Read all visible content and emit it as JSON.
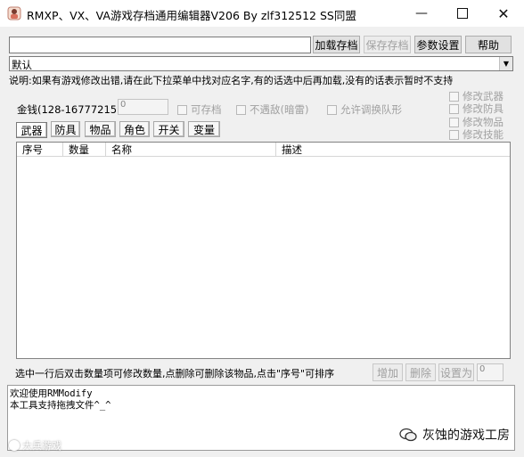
{
  "window": {
    "title": "RMXP、VX、VA游戏存档通用编辑器V206 By zlf312512 SS同盟",
    "icons": [
      "app-icon",
      "minimize-icon",
      "maximize-icon",
      "close-icon"
    ]
  },
  "toolbar": {
    "path_value": "",
    "load_label": "加载存档",
    "save_label": "保存存档",
    "settings_label": "参数设置",
    "help_label": "帮助"
  },
  "preset": {
    "selected": "默认"
  },
  "note": "说明:如果有游戏修改出错,请在此下拉菜单中找对应名字,有的话选中后再加载,没有的话表示暂时不支持",
  "edit_checks": [
    "修改武器",
    "修改防具",
    "修改物品",
    "修改技能"
  ],
  "gold": {
    "label": "金钱(128-16777215)",
    "value": "0",
    "options": [
      "可存档",
      "不遇敌(暗雷)",
      "允许调换队形"
    ]
  },
  "tabs": [
    "武器",
    "防具",
    "物品",
    "角色",
    "开关",
    "变量"
  ],
  "table": {
    "columns": [
      "序号",
      "数量",
      "名称",
      "描述"
    ],
    "rows": []
  },
  "bottom": {
    "hint": "选中一行后双击数量项可修改数量,点删除可删除该物品,点击\"序号\"可排序",
    "add_label": "增加",
    "delete_label": "删除",
    "setas_label": "设置为",
    "setas_value": "0"
  },
  "log": {
    "lines": [
      "欢迎使用RMModify",
      "本工具支持拖拽文件^_^"
    ]
  },
  "overlay": {
    "watermark_left": "大兵游戏",
    "brand_right": "灰蚀的游戏工房"
  }
}
